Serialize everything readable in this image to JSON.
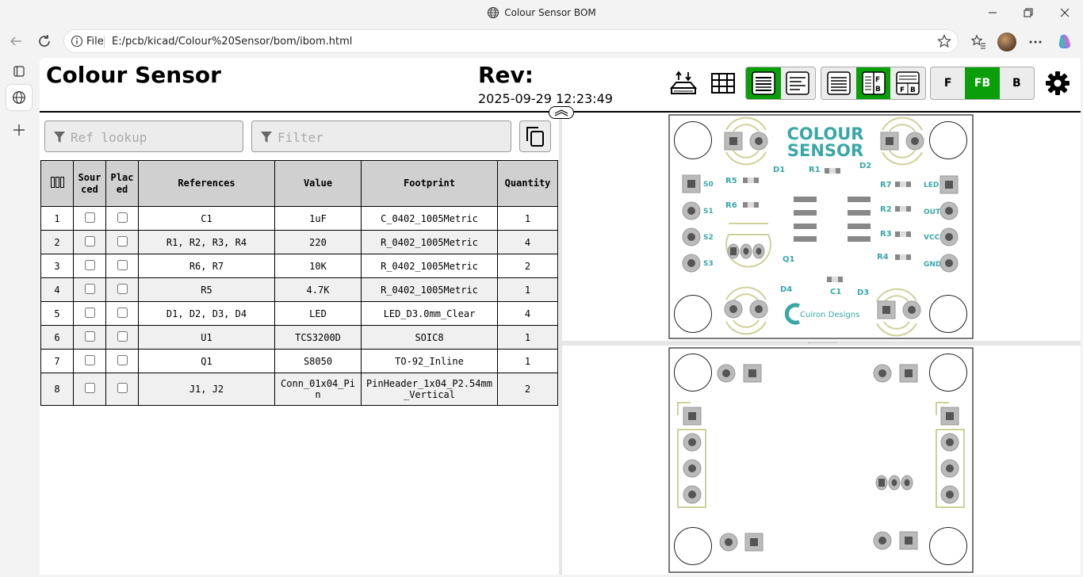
{
  "window": {
    "title": "Colour Sensor BOM"
  },
  "addressbar": {
    "scheme_label": "File",
    "url": "E:/pcb/kicad/Colour%20Sensor/bom/ibom.html"
  },
  "header": {
    "title": "Colour Sensor",
    "rev_label": "Rev:",
    "date": "2025-09-29 12:23:49"
  },
  "controls": {
    "layers": {
      "front": "F",
      "both": "FB",
      "back": "B",
      "active": "FB"
    },
    "bom_mode_active": "grouped",
    "layout_active": "left-right"
  },
  "filters": {
    "ref_placeholder": "Ref lookup",
    "filter_placeholder": "Filter"
  },
  "bom": {
    "headers": {
      "sourced": "Sour ced",
      "placed": "Plac ed",
      "references": "References",
      "value": "Value",
      "footprint": "Footprint",
      "quantity": "Quantity"
    },
    "rows": [
      {
        "n": "1",
        "refs": "C1",
        "value": "1uF",
        "footprint": "C_0402_1005Metric",
        "qty": "1"
      },
      {
        "n": "2",
        "refs": "R1, R2, R3, R4",
        "value": "220",
        "footprint": "R_0402_1005Metric",
        "qty": "4"
      },
      {
        "n": "3",
        "refs": "R6, R7",
        "value": "10K",
        "footprint": "R_0402_1005Metric",
        "qty": "2"
      },
      {
        "n": "4",
        "refs": "R5",
        "value": "4.7K",
        "footprint": "R_0402_1005Metric",
        "qty": "1"
      },
      {
        "n": "5",
        "refs": "D1, D2, D3, D4",
        "value": "LED",
        "footprint": "LED_D3.0mm_Clear",
        "qty": "4"
      },
      {
        "n": "6",
        "refs": "U1",
        "value": "TCS3200D",
        "footprint": "SOIC8",
        "qty": "1"
      },
      {
        "n": "7",
        "refs": "Q1",
        "value": "S8050",
        "footprint": "TO-92_Inline",
        "qty": "1"
      },
      {
        "n": "8",
        "refs": "J1, J2",
        "value": "Conn_01x04_Pin",
        "footprint": "PinHeader_1x04_P2.54mm_Vertical",
        "qty": "2"
      }
    ]
  },
  "pcb": {
    "silk_color": "#3aa6a6",
    "title_line1": "COLOUR",
    "title_line2": "SENSOR",
    "logo_text": "Cuiron Designs",
    "labels": {
      "d1": "D1",
      "d2": "D2",
      "d3": "D3",
      "d4": "D4",
      "r1": "R1",
      "r2": "R2",
      "r3": "R3",
      "r4": "R4",
      "r5": "R5",
      "r6": "R6",
      "r7": "R7",
      "c1": "C1",
      "q1": "Q1",
      "s0": "S0",
      "s1": "S1",
      "s2": "S2",
      "s3": "S3",
      "led": "LED",
      "out": "OUT",
      "vcc": "VCC",
      "gnd": "GND"
    }
  }
}
